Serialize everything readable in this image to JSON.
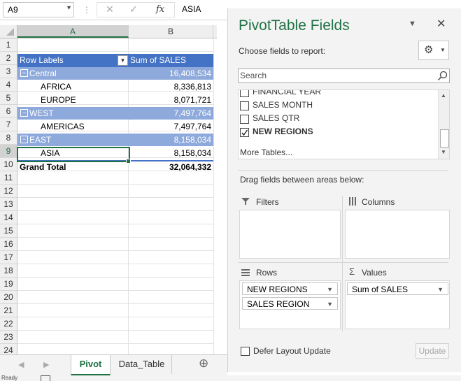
{
  "formula_bar": {
    "name_box": "A9",
    "cancel_glyph": "✕",
    "enter_glyph": "✓",
    "fx_label": "fx",
    "formula_value": "ASIA"
  },
  "grid": {
    "columns": [
      "A",
      "B"
    ],
    "rows": [
      "1",
      "2",
      "3",
      "4",
      "5",
      "6",
      "7",
      "8",
      "9",
      "10",
      "11",
      "12",
      "13",
      "14",
      "15",
      "16",
      "17",
      "18",
      "19",
      "20",
      "21",
      "22",
      "23",
      "24"
    ],
    "header_row": {
      "row_labels": "Row Labels",
      "sum_label": "Sum of SALES"
    },
    "pivot_rows": [
      {
        "label": "Central",
        "value": "16,408,534",
        "type": "group"
      },
      {
        "label": "AFRICA",
        "value": "8,336,813",
        "type": "item"
      },
      {
        "label": "EUROPE",
        "value": "8,071,721",
        "type": "item"
      },
      {
        "label": "WEST",
        "value": "7,497,764",
        "type": "group"
      },
      {
        "label": "AMERICAS",
        "value": "7,497,764",
        "type": "item"
      },
      {
        "label": "EAST",
        "value": "8,158,034",
        "type": "group"
      },
      {
        "label": "ASIA",
        "value": "8,158,034",
        "type": "item"
      }
    ],
    "grand_total": {
      "label": "Grand Total",
      "value": "32,064,332"
    },
    "collapse_glyph": "−"
  },
  "sheet_tabs": {
    "tabs": [
      "Pivot",
      "Data_Table"
    ],
    "active": "Pivot",
    "add_glyph": "⊕"
  },
  "status_bar": {
    "text": "Ready"
  },
  "pivot_pane": {
    "title": "PivotTable Fields",
    "subtitle": "Choose fields to report:",
    "search_placeholder": "Search",
    "fields": [
      {
        "label": "FINANCIAL YEAR",
        "checked": false
      },
      {
        "label": "SALES MONTH",
        "checked": false
      },
      {
        "label": "SALES QTR",
        "checked": false
      },
      {
        "label": "NEW REGIONS",
        "checked": true
      }
    ],
    "more_tables": "More Tables...",
    "drag_hint": "Drag fields between areas below:",
    "areas": {
      "filters": "Filters",
      "columns": "Columns",
      "rows": "Rows",
      "values": "Values"
    },
    "rows_fields": [
      "NEW REGIONS",
      "SALES REGION"
    ],
    "values_fields": [
      "Sum of SALES"
    ],
    "defer_label": "Defer Layout Update",
    "update_label": "Update"
  },
  "colors": {
    "header_blue": "#4472c4",
    "group_blue": "#8ea9db",
    "excel_green": "#217346"
  }
}
